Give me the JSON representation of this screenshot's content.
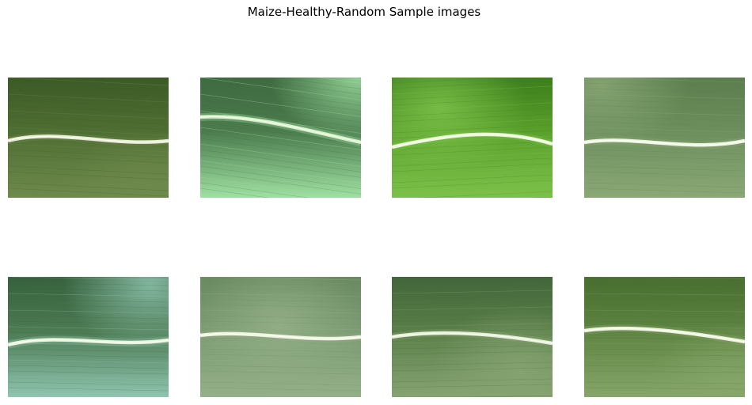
{
  "figure": {
    "title": "Maize-Healthy-Random Sample images"
  },
  "images": [
    {
      "alt": "maize leaf close-up, dark green, bright midrib",
      "colors": {
        "base": "#4f6e33",
        "light": "#6e8a4c",
        "dark": "#3c5a26",
        "midrib": "#e6ead2"
      }
    },
    {
      "alt": "maize leaf close-up, green, diagonal midrib",
      "colors": {
        "base": "#4c7c4e",
        "light": "#9fe0a2",
        "dark": "#3e6a40",
        "midrib": "#d8f0c8"
      }
    },
    {
      "alt": "maize leaf close-up, bright lime green",
      "colors": {
        "base": "#5aa02c",
        "light": "#7cc24a",
        "dark": "#3c7e1c",
        "midrib": "#eaf6d4"
      }
    },
    {
      "alt": "maize leaf close-up, pale sage green",
      "colors": {
        "base": "#6d8f5e",
        "light": "#8aa876",
        "dark": "#5c7e4e",
        "midrib": "#eef4e2"
      }
    },
    {
      "alt": "maize leaf close-up, teal green",
      "colors": {
        "base": "#4c7a52",
        "light": "#8fc4b0",
        "dark": "#36613c",
        "midrib": "#e8f2d8"
      }
    },
    {
      "alt": "maize leaf close-up, muted grey green",
      "colors": {
        "base": "#7a9a72",
        "light": "#94b088",
        "dark": "#6a8a62",
        "midrib": "#eef2de"
      }
    },
    {
      "alt": "maize leaf close-up, mid green",
      "colors": {
        "base": "#5a7e48",
        "light": "#86a472",
        "dark": "#42663a",
        "midrib": "#e6eed6"
      }
    },
    {
      "alt": "maize leaf close-up, olive green",
      "colors": {
        "base": "#5e8442",
        "light": "#86a66a",
        "dark": "#486e30",
        "midrib": "#eef2dc"
      }
    }
  ]
}
